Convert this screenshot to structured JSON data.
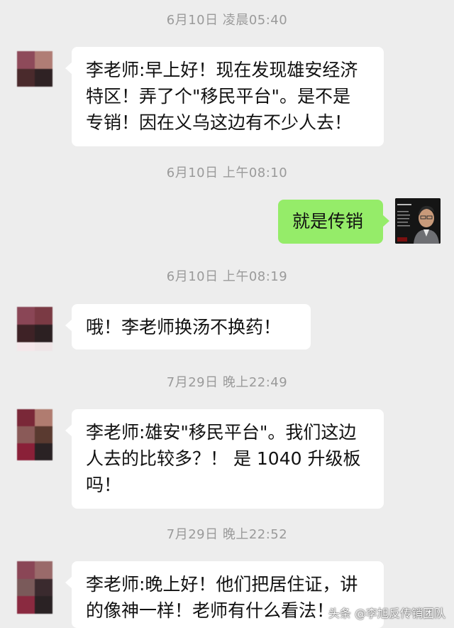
{
  "chat": {
    "messages": [
      {
        "time": "6月10日 凌晨05:40",
        "sender": "other",
        "lines": [
          "李老师:早上好！现在发现雄安经济",
          "特区！弄了个\"移民平台\"。是不是",
          "专销！因在义乌这边有不少人去！"
        ]
      },
      {
        "time": "6月10日 上午08:10",
        "sender": "me",
        "lines": [
          "就是传销"
        ]
      },
      {
        "time": "6月10日 上午08:19",
        "sender": "other",
        "lines": [
          "哦！李老师换汤不换药！"
        ]
      },
      {
        "time": "7月29日 晚上22:49",
        "sender": "other",
        "lines": [
          "李老师:雄安\"移民平台\"。我们这边",
          "人去的比较多？！ 是 1040 升级板",
          "吗！"
        ]
      },
      {
        "time": "7月29日 晚上22:52",
        "sender": "other",
        "lines": [
          "李老师:晚上好！他们把居住证，讲",
          "的像神一样！老师有什么看法！"
        ]
      }
    ]
  },
  "watermark": "头条 @李旭反传销团队",
  "colors": {
    "background": "#ededed",
    "bubble_other": "#ffffff",
    "bubble_me": "#95ec69",
    "timestamp": "#9a9a9a"
  }
}
